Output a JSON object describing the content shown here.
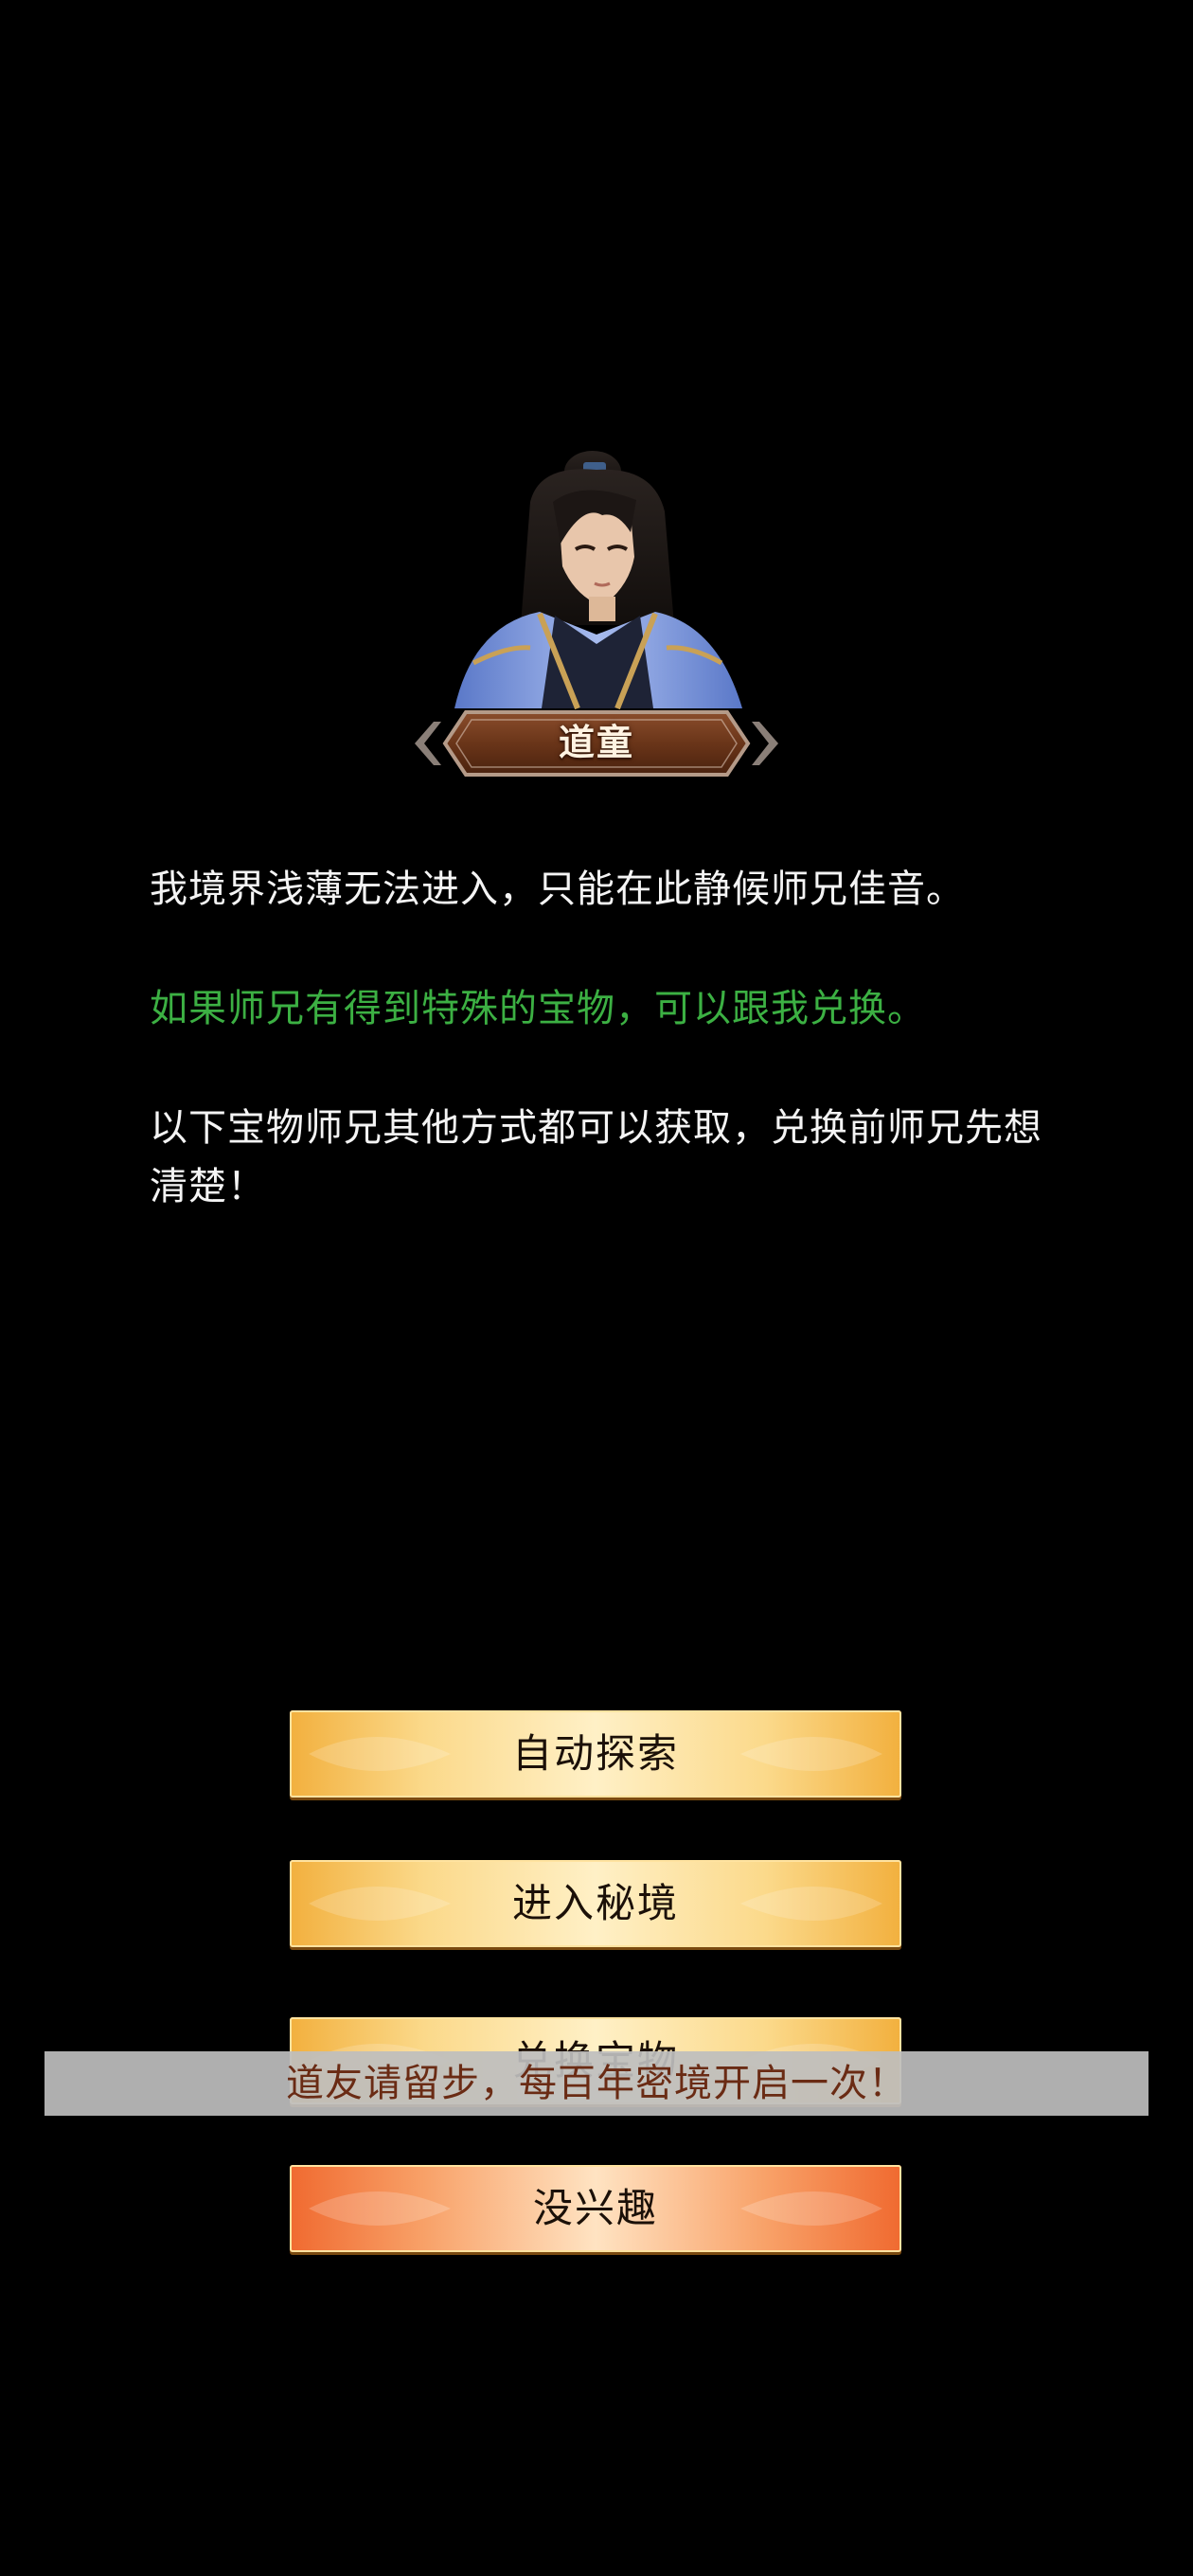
{
  "npc": {
    "name": "道童",
    "portrait_icon": "taoist-disciple-portrait-icon"
  },
  "dialog": {
    "line1": "我境界浅薄无法进入，只能在此静候师兄佳音。",
    "line2": "如果师兄有得到特殊的宝物，可以跟我兑换。",
    "line3": "以下宝物师兄其他方式都可以获取，兑换前师兄先想清楚！"
  },
  "buttons": {
    "auto_explore": "自动探索",
    "enter_realm": "进入秘境",
    "exchange_treasure": "兑换宝物",
    "not_interested": "没兴趣"
  },
  "toast": {
    "message": "道友请留步，每百年密境开启一次！"
  },
  "colors": {
    "green_text": "#3cb043",
    "gold_button": "#fbd98a",
    "orange_button": "#f8a168",
    "toast_text": "#6a2b14"
  }
}
